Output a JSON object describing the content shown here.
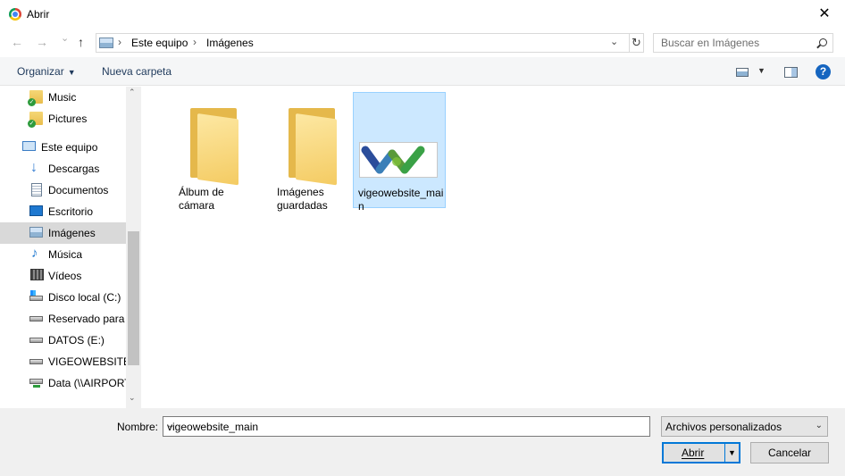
{
  "window": {
    "title": "Abrir",
    "close": "✕"
  },
  "nav": {
    "back": "←",
    "forward": "→",
    "recent": "⌄",
    "up": "↑"
  },
  "address": {
    "crumbs": [
      "Este equipo",
      "Imágenes"
    ],
    "separator": "›",
    "dropdown": "⌄",
    "refresh": "↻"
  },
  "search": {
    "placeholder": "Buscar en Imágenes"
  },
  "toolbar": {
    "organize": "Organizar",
    "organize_caret": "▼",
    "new_folder": "Nueva carpeta",
    "view_caret": "▼",
    "help": "?"
  },
  "sidebar": {
    "items": [
      {
        "label": "Music",
        "icon": "folder-music-icon"
      },
      {
        "label": "Pictures",
        "icon": "folder-pictures-icon"
      },
      {
        "label": "Este equipo",
        "icon": "pc-icon"
      },
      {
        "label": "Descargas",
        "icon": "download-icon"
      },
      {
        "label": "Documentos",
        "icon": "documents-icon"
      },
      {
        "label": "Escritorio",
        "icon": "desktop-icon"
      },
      {
        "label": "Imágenes",
        "icon": "images-icon",
        "selected": true
      },
      {
        "label": "Música",
        "icon": "music-icon"
      },
      {
        "label": "Vídeos",
        "icon": "videos-icon"
      },
      {
        "label": "Disco local (C:)",
        "icon": "local-disk-icon"
      },
      {
        "label": "Reservado para e",
        "icon": "drive-icon"
      },
      {
        "label": "DATOS (E:)",
        "icon": "drive-icon"
      },
      {
        "label": "VIGEOWEBSITE (",
        "icon": "drive-icon"
      },
      {
        "label": "Data (\\\\AIRPORT",
        "icon": "network-drive-icon"
      }
    ],
    "scroll_up": "⌃",
    "scroll_down": "⌄"
  },
  "files": [
    {
      "name": "Álbum de cámara",
      "type": "folder"
    },
    {
      "name": "Imágenes guardadas",
      "type": "folder"
    },
    {
      "name": "vigeowebsite_main",
      "type": "image",
      "selected": true
    }
  ],
  "footer": {
    "name_label": "Nombre:",
    "name_value": "vigeowebsite_main",
    "name_dropdown": "⌄",
    "filter": "Archivos personalizados",
    "filter_dropdown": "⌄",
    "open": "Abrir",
    "open_split": "▼",
    "cancel": "Cancelar"
  },
  "colors": {
    "accent": "#0078d7",
    "selection": "#cce8ff",
    "sidebar_selection": "#d9d9d9",
    "logo_blue": "#2b4d9b",
    "logo_green": "#3aa146"
  }
}
